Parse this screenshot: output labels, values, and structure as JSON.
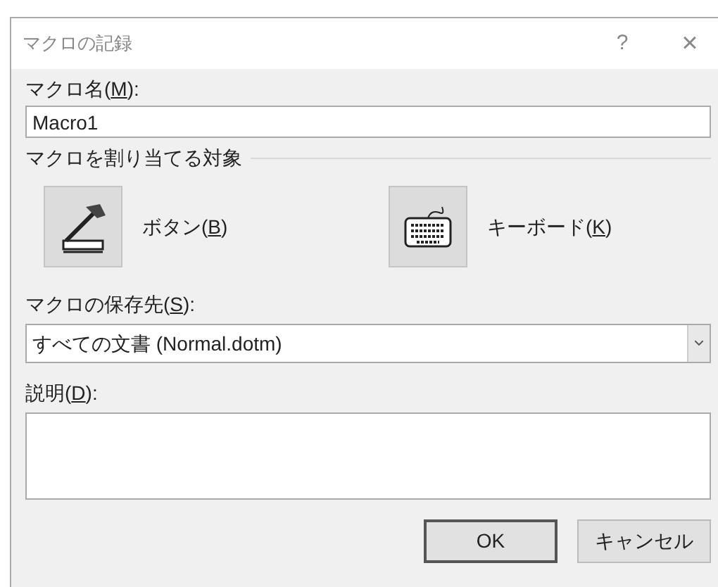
{
  "window": {
    "title": "マクロの記録",
    "help": "?",
    "close": "×"
  },
  "macro_name": {
    "label": {
      "before": "マクロ名(",
      "key": "M",
      "after": "):"
    },
    "value": "Macro1"
  },
  "assign_to": {
    "title": "マクロを割り当てる対象",
    "options": [
      {
        "kind": "button",
        "label": {
          "before": "ボタン(",
          "key": "B",
          "after": ")"
        }
      },
      {
        "kind": "keyboard",
        "label": {
          "before": "キーボード(",
          "key": "K",
          "after": ")"
        }
      }
    ]
  },
  "store_in": {
    "label": {
      "before": "マクロの保存先(",
      "key": "S",
      "after": "):"
    },
    "value": "すべての文書 (Normal.dotm)"
  },
  "description": {
    "label": {
      "before": "説明(",
      "key": "D",
      "after": "):"
    }
  },
  "buttons": [
    {
      "label": "OK",
      "default": true
    },
    {
      "label": "キャンセル",
      "default": false
    }
  ]
}
